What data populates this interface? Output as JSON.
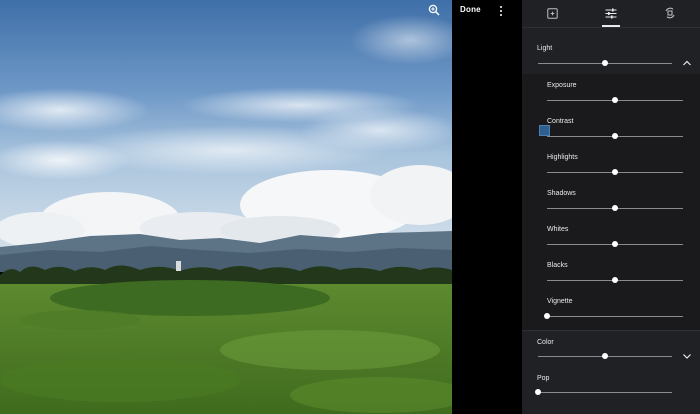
{
  "toolbar": {
    "done_label": "Done",
    "zoom_icon": "zoom-in-icon",
    "more_icon": "more-vert-icon"
  },
  "tabs": [
    {
      "name": "filters-tab",
      "icon": "photo-filter-icon",
      "active": false
    },
    {
      "name": "adjust-tab",
      "icon": "tune-icon",
      "active": true
    },
    {
      "name": "crop-rotate-tab",
      "icon": "crop-rotate-icon",
      "active": false
    }
  ],
  "light": {
    "label": "Light",
    "value": 0.5,
    "expanded": true,
    "sliders": [
      {
        "label": "Exposure",
        "value": 0.5
      },
      {
        "label": "Contrast",
        "value": 0.5
      },
      {
        "label": "Highlights",
        "value": 0.5
      },
      {
        "label": "Shadows",
        "value": 0.5
      },
      {
        "label": "Whites",
        "value": 0.5
      },
      {
        "label": "Blacks",
        "value": 0.5
      },
      {
        "label": "Vignette",
        "value": 0.0
      }
    ]
  },
  "color": {
    "label": "Color",
    "value": 0.5,
    "expanded": false
  },
  "pop": {
    "label": "Pop",
    "value": 0.0
  },
  "colors": {
    "panel_bg": "#202124",
    "group_bg": "#1a1a1c",
    "accent_white": "#ffffff"
  }
}
